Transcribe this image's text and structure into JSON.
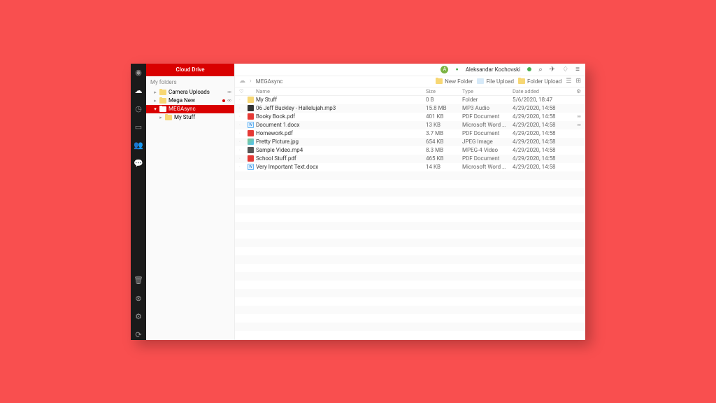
{
  "header": {
    "title": "Cloud Drive"
  },
  "user": {
    "initial": "A",
    "name": "Aleksandar Kochovski"
  },
  "sidebar": {
    "section": "My folders",
    "items": [
      {
        "label": "Camera Uploads",
        "indent": 1,
        "link": true
      },
      {
        "label": "Mega New",
        "indent": 1,
        "link": true,
        "dot": true
      },
      {
        "label": "MEGAsync",
        "indent": 1,
        "selected": true,
        "expanded": true
      },
      {
        "label": "My Stuff",
        "indent": 2
      }
    ]
  },
  "breadcrumb": {
    "current": "MEGAsync"
  },
  "toolbar": {
    "newFolder": "New Folder",
    "fileUpload": "File Upload",
    "folderUpload": "Folder Upload"
  },
  "columns": {
    "name": "Name",
    "size": "Size",
    "type": "Type",
    "date": "Date added"
  },
  "files": [
    {
      "icon": "folder",
      "name": "My Stuff",
      "size": "0 B",
      "type": "Folder",
      "date": "5/6/2020, 18:47"
    },
    {
      "icon": "audio",
      "name": "06 Jeff Buckley - Hallelujah.mp3",
      "size": "15.8 MB",
      "type": "MP3 Audio",
      "date": "4/29/2020, 14:58"
    },
    {
      "icon": "pdf",
      "name": "Booky Book.pdf",
      "size": "401 KB",
      "type": "PDF Document",
      "date": "4/29/2020, 14:58",
      "link": true
    },
    {
      "icon": "docx",
      "name": "Document 1.docx",
      "size": "13 KB",
      "type": "Microsoft Word …",
      "date": "4/29/2020, 14:58",
      "link": true
    },
    {
      "icon": "pdf",
      "name": "Homework.pdf",
      "size": "3.7 MB",
      "type": "PDF Document",
      "date": "4/29/2020, 14:58"
    },
    {
      "icon": "img",
      "name": "Pretty Picture.jpg",
      "size": "654 KB",
      "type": "JPEG Image",
      "date": "4/29/2020, 14:58"
    },
    {
      "icon": "vid",
      "name": "Sample Video.mp4",
      "size": "8.3 MB",
      "type": "MPEG-4 Video",
      "date": "4/29/2020, 14:58"
    },
    {
      "icon": "pdf",
      "name": "School Stuff.pdf",
      "size": "465 KB",
      "type": "PDF Document",
      "date": "4/29/2020, 14:58"
    },
    {
      "icon": "docx",
      "name": "Very Important Text.docx",
      "size": "14 KB",
      "type": "Microsoft Word …",
      "date": "4/29/2020, 14:58"
    }
  ]
}
